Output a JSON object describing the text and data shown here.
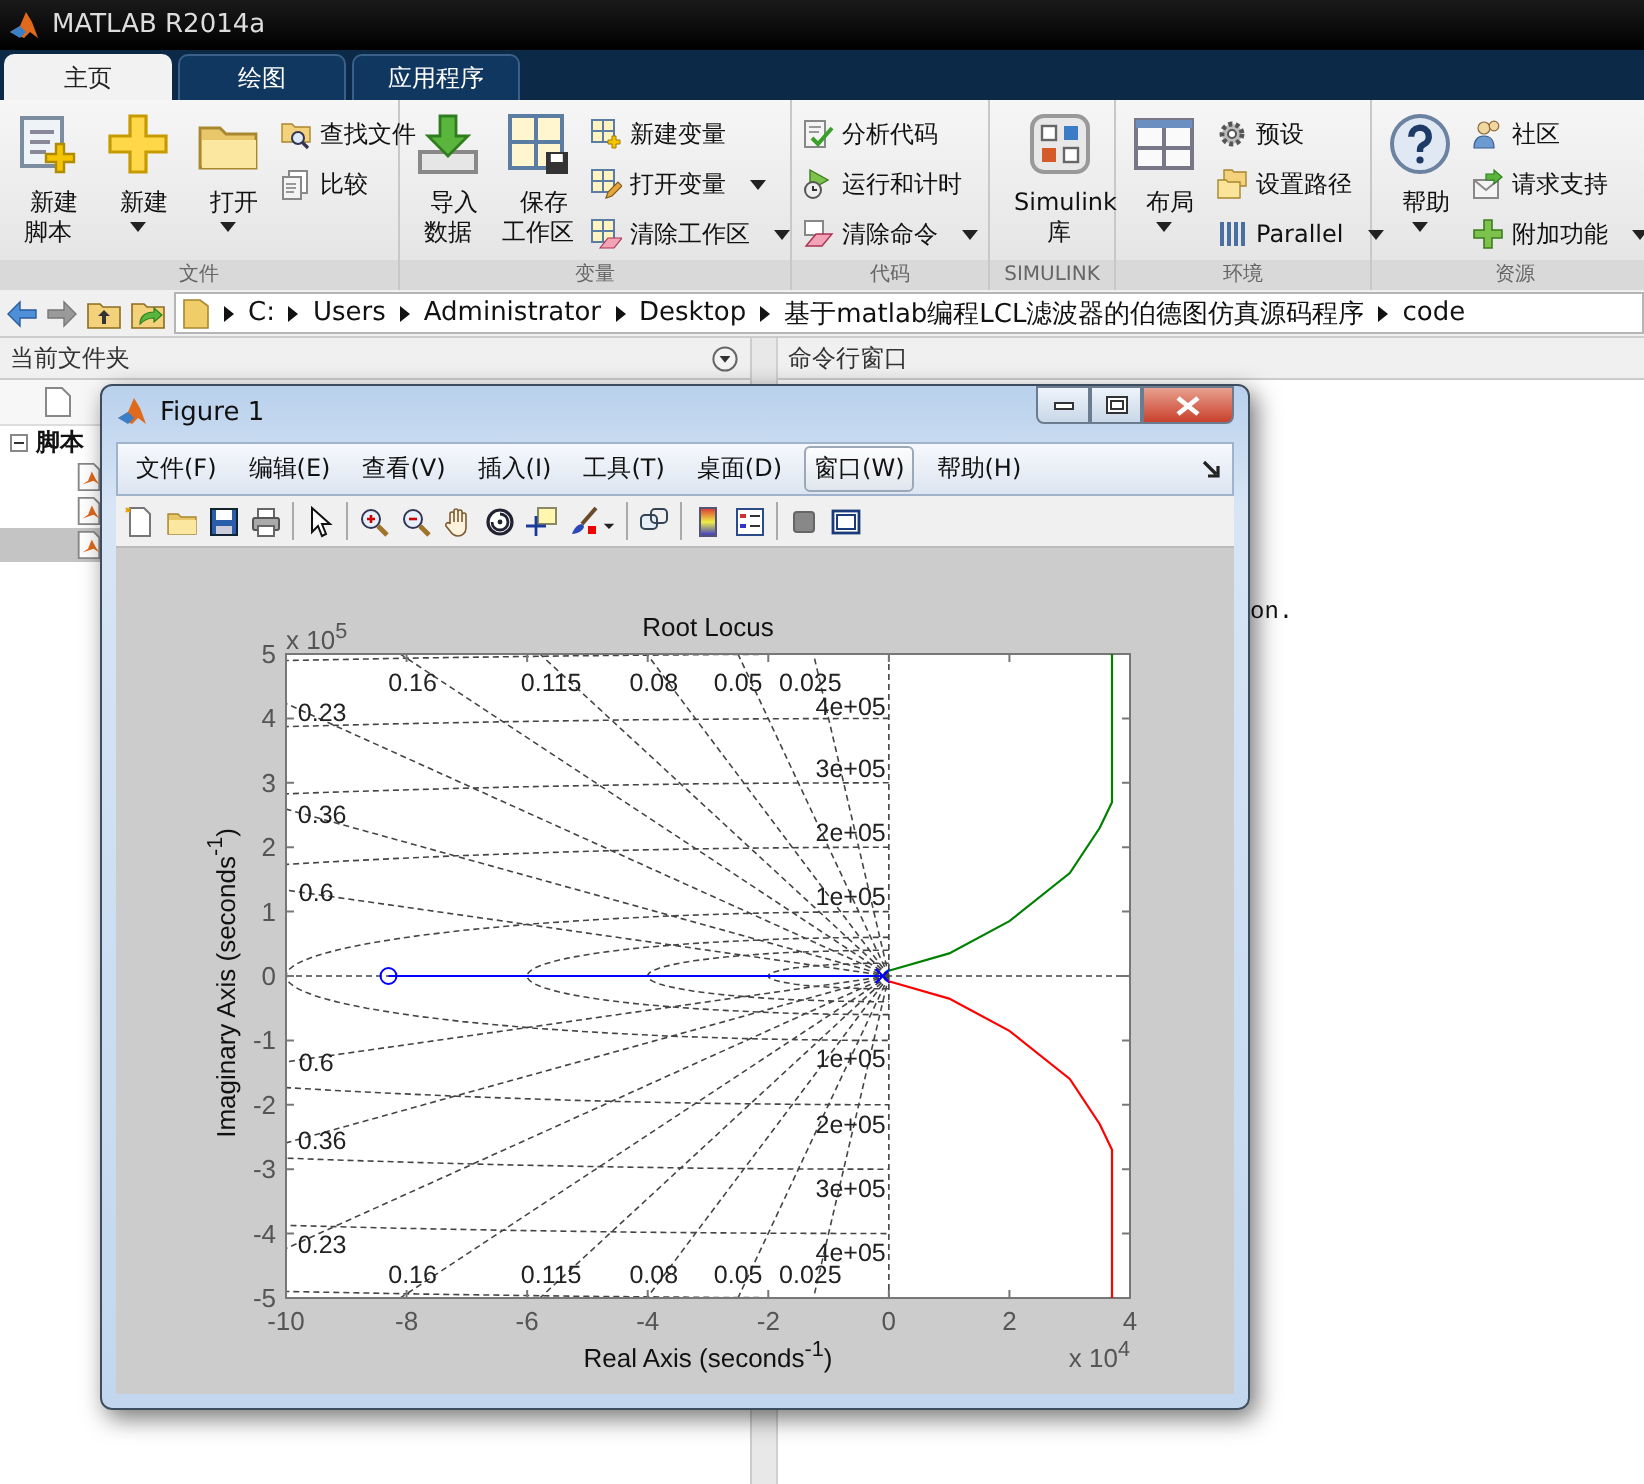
{
  "window": {
    "title": "MATLAB R2014a"
  },
  "tabs": [
    {
      "label": "主页",
      "selected": true
    },
    {
      "label": "绘图",
      "selected": false
    },
    {
      "label": "应用程序",
      "selected": false
    }
  ],
  "toolstrip": [
    {
      "title": "文件",
      "items": [
        {
          "kind": "large",
          "label": "新建脚本",
          "menu": false
        },
        {
          "kind": "large",
          "label": "新建",
          "menu": true
        },
        {
          "kind": "large",
          "label": "打开",
          "menu": true
        },
        {
          "kind": "column",
          "buttons": [
            {
              "label": "查找文件",
              "menu": false
            },
            {
              "label": "比较",
              "menu": false
            }
          ]
        }
      ]
    },
    {
      "title": "变量",
      "items": [
        {
          "kind": "large",
          "label": "导入数据",
          "menu": false
        },
        {
          "kind": "large",
          "label": "保存工作区",
          "menu": false
        },
        {
          "kind": "column",
          "buttons": [
            {
              "label": "新建变量",
              "menu": false
            },
            {
              "label": "打开变量",
              "menu": true
            },
            {
              "label": "清除工作区",
              "menu": true
            }
          ]
        }
      ]
    },
    {
      "title": "代码",
      "items": [
        {
          "kind": "column",
          "buttons": [
            {
              "label": "分析代码",
              "menu": false
            },
            {
              "label": "运行和计时",
              "menu": false
            },
            {
              "label": "清除命令",
              "menu": true
            }
          ]
        }
      ]
    },
    {
      "title": "SIMULINK",
      "items": [
        {
          "kind": "large",
          "label": "Simulink库",
          "menu": false
        }
      ]
    },
    {
      "title": "环境",
      "items": [
        {
          "kind": "large",
          "label": "布局",
          "menu": true
        },
        {
          "kind": "column",
          "buttons": [
            {
              "label": "预设",
              "menu": false
            },
            {
              "label": "设置路径",
              "menu": false
            },
            {
              "label": "Parallel",
              "menu": true
            }
          ]
        }
      ]
    },
    {
      "title": "资源",
      "items": [
        {
          "kind": "large",
          "label": "帮助",
          "menu": true
        },
        {
          "kind": "column",
          "buttons": [
            {
              "label": "社区",
              "menu": false
            },
            {
              "label": "请求支持",
              "menu": false
            },
            {
              "label": "附加功能",
              "menu": true
            }
          ]
        }
      ]
    }
  ],
  "path_bar": {
    "crumbs": [
      "C:",
      "Users",
      "Administrator",
      "Desktop",
      "基于matlab编程LCL滤波器的伯德图仿真源码程序",
      "code"
    ]
  },
  "file_panel": {
    "title": "当前文件夹",
    "tree": [
      {
        "label": "脚本",
        "expanded": true,
        "selected": false,
        "children": [
          {
            "selected": false
          },
          {
            "selected": false
          },
          {
            "selected": true
          }
        ]
      }
    ]
  },
  "command_window": {
    "title": "命令行窗口",
    "lines": [
      "on."
    ]
  },
  "figure": {
    "title": "Figure 1",
    "menus": [
      {
        "label": "文件(F)",
        "selected": false
      },
      {
        "label": "编辑(E)",
        "selected": false
      },
      {
        "label": "查看(V)",
        "selected": false
      },
      {
        "label": "插入(I)",
        "selected": false
      },
      {
        "label": "工具(T)",
        "selected": false
      },
      {
        "label": "桌面(D)",
        "selected": false
      },
      {
        "label": "窗口(W)",
        "selected": true
      },
      {
        "label": "帮助(H)",
        "selected": false
      }
    ],
    "x_multiplier": "x 10$^{4}$",
    "y_multiplier": "x 10$^{5}$",
    "chart_data": {
      "type": "line",
      "title": "Root Locus",
      "xlabel": "Real Axis (seconds$^{-1}$)",
      "ylabel": "Imaginary Axis (seconds$^{-1}$)",
      "x": [
        -8.3,
        -0.1,
        0,
        1,
        2,
        3,
        3.5,
        3.7,
        3.7
      ],
      "series": [
        {
          "color": "#0000ff",
          "marker": "o",
          "values": [
            0,
            0,
            null,
            null,
            null,
            null,
            null,
            null,
            null
          ]
        },
        {
          "color": "#008000",
          "values": [
            null,
            null,
            0.08,
            0.35,
            0.85,
            1.6,
            2.3,
            2.7,
            5
          ]
        },
        {
          "color": "#ff0000",
          "values": [
            null,
            null,
            -0.08,
            -0.35,
            -0.85,
            -1.6,
            -2.3,
            -2.7,
            -5
          ]
        }
      ],
      "xlim": [
        -10,
        4
      ],
      "ylim": [
        -5,
        5
      ],
      "xticks": [
        -10,
        -8,
        -6,
        -4,
        -2,
        0,
        2,
        4
      ],
      "yticks": [
        -5,
        -4,
        -3,
        -2,
        -1,
        0,
        1,
        2,
        3,
        4,
        5
      ],
      "annotations": [
        "0.16",
        "0.115",
        "0.08",
        "0.05",
        "0.025",
        "0.23",
        "0.36",
        "0.6",
        "4e+05",
        "3e+05",
        "2e+05",
        "1e+05",
        "0.6",
        "0.36",
        "0.23",
        "1e+05",
        "2e+05",
        "3e+05",
        "4e+05",
        "0.16",
        "0.115",
        "0.08",
        "0.05",
        "0.025"
      ]
    }
  }
}
